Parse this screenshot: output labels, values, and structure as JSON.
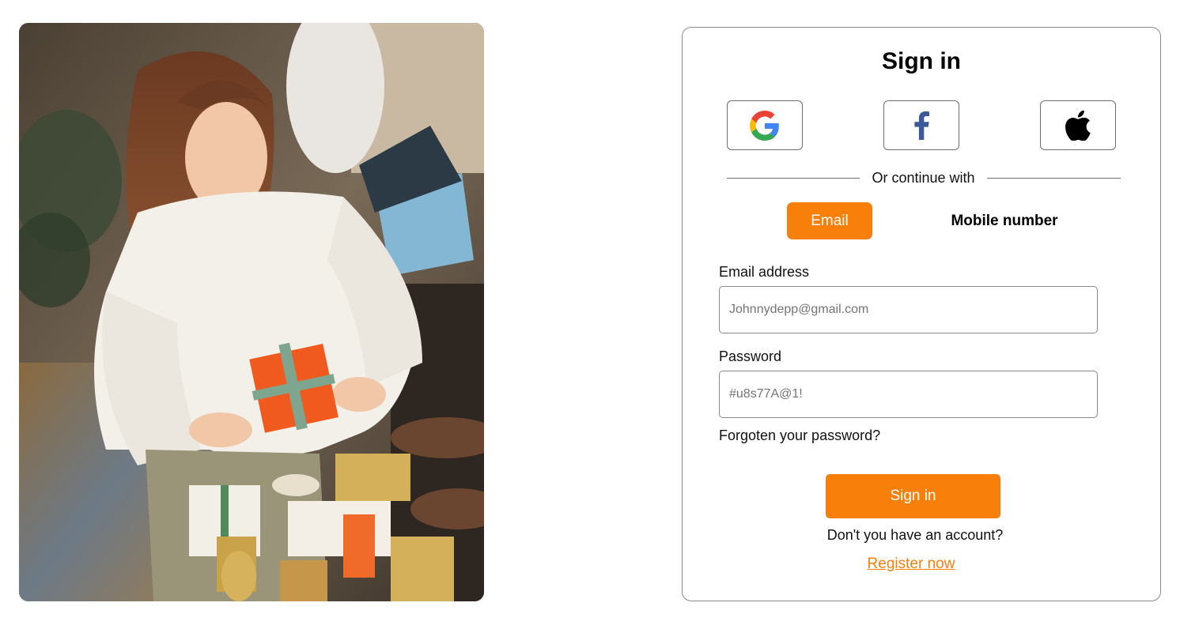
{
  "hero": {
    "alt": "Woman in a white knit sweater wrapping Christmas gifts"
  },
  "card": {
    "title": "Sign in",
    "social": [
      {
        "provider": "Google",
        "icon": "google-icon"
      },
      {
        "provider": "Facebook",
        "icon": "facebook-icon"
      },
      {
        "provider": "Apple",
        "icon": "apple-icon"
      }
    ],
    "divider_text": "Or continue with",
    "tabs": {
      "email": "Email",
      "mobile": "Mobile number",
      "active": "email"
    },
    "email_label": "Email address",
    "email_placeholder": "Johnnydepp@gmail.com",
    "password_label": "Password",
    "password_placeholder": "#u8s77A@1!",
    "forgot": "Forgoten your password?",
    "submit": "Sign in",
    "no_account": "Don't you have an account?",
    "register": "Register now"
  },
  "colors": {
    "accent": "#f97f0b",
    "border": "#8a8a8a",
    "facebook": "#3b5998",
    "google_blue": "#4285F4",
    "google_red": "#EA4335",
    "google_yellow": "#FBBC05",
    "google_green": "#34A853"
  }
}
